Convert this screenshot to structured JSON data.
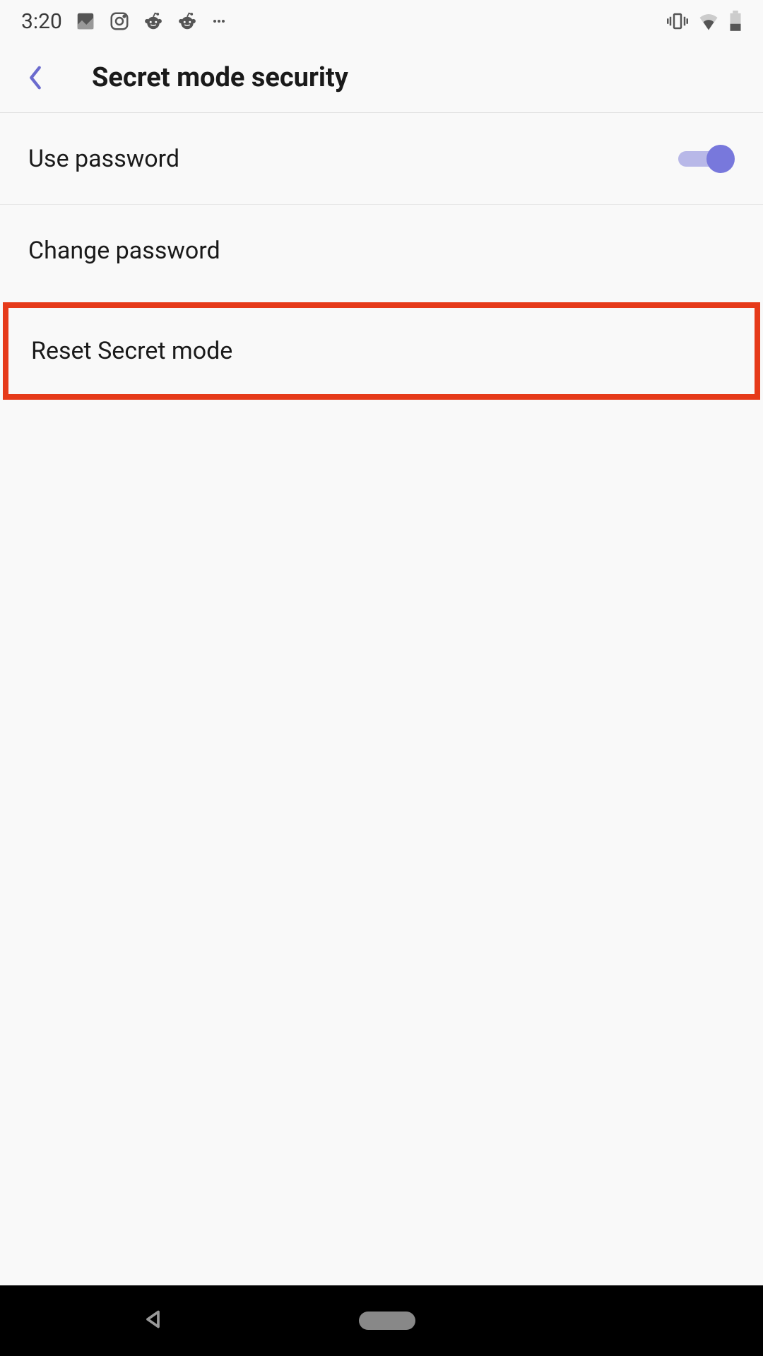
{
  "statusBar": {
    "time": "3:20"
  },
  "header": {
    "title": "Secret mode security"
  },
  "settings": {
    "usePassword": {
      "label": "Use password",
      "toggleOn": true
    },
    "changePassword": {
      "label": "Change password"
    },
    "resetSecretMode": {
      "label": "Reset Secret mode"
    }
  }
}
